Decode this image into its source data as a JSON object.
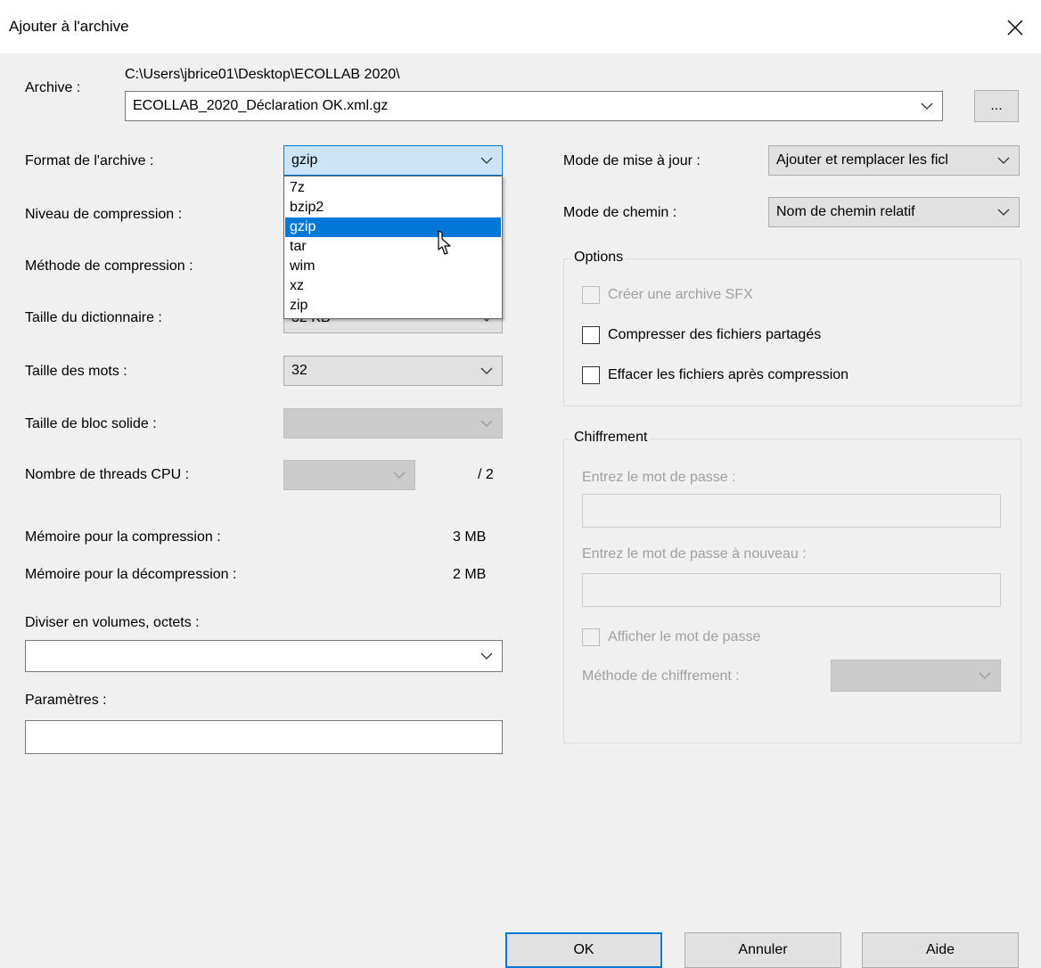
{
  "window": {
    "title": "Ajouter à l'archive",
    "close_icon": "close-icon"
  },
  "archive": {
    "label": "Archive :",
    "path": "C:\\Users\\jbrice01\\Desktop\\ECOLLAB 2020\\",
    "filename": "ECOLLAB_2020_Déclaration OK.xml.gz",
    "browse_label": "..."
  },
  "left": {
    "format_label": "Format de l'archive :",
    "format_value": "gzip",
    "format_options": [
      "7z",
      "bzip2",
      "gzip",
      "tar",
      "wim",
      "xz",
      "zip"
    ],
    "format_selected": "gzip",
    "level_label": "Niveau de compression :",
    "method_label": "Méthode de compression :",
    "dict_label": "Taille du dictionnaire :",
    "dict_value": "32 KB",
    "words_label": "Taille des mots :",
    "words_value": "32",
    "solid_label": "Taille de bloc solide :",
    "threads_label": "Nombre de threads CPU :",
    "threads_total": "/ 2",
    "mem_comp_label": "Mémoire pour la compression :",
    "mem_comp_value": "3 MB",
    "mem_decomp_label": "Mémoire pour la décompression :",
    "mem_decomp_value": "2 MB",
    "volumes_label": "Diviser en volumes, octets :",
    "volumes_value": "",
    "params_label": "Paramètres :",
    "params_value": ""
  },
  "right": {
    "update_label": "Mode de mise à jour :",
    "update_value": "Ajouter et remplacer les ficl",
    "path_label": "Mode de chemin :",
    "path_value": "Nom de chemin relatif",
    "options_title": "Options",
    "opt_sfx": {
      "label": "Créer une archive SFX",
      "checked": false,
      "disabled": true
    },
    "opt_shared": {
      "label": "Compresser des fichiers partagés",
      "checked": false
    },
    "opt_delete": {
      "label": "Effacer les fichiers après compression",
      "checked": false
    },
    "encryption_title": "Chiffrement",
    "pwd_label": "Entrez le mot de passe :",
    "pwd_again_label": "Entrez le mot de passe à nouveau :",
    "show_pwd": {
      "label": "Afficher le mot de passe",
      "checked": false,
      "disabled": true
    },
    "enc_method_label": "Méthode de chiffrement :"
  },
  "buttons": {
    "ok": "OK",
    "cancel": "Annuler",
    "help": "Aide"
  },
  "colors": {
    "accent": "#0078d7",
    "selection": "#0078d7",
    "disabled_text": "#a0a0a0"
  }
}
